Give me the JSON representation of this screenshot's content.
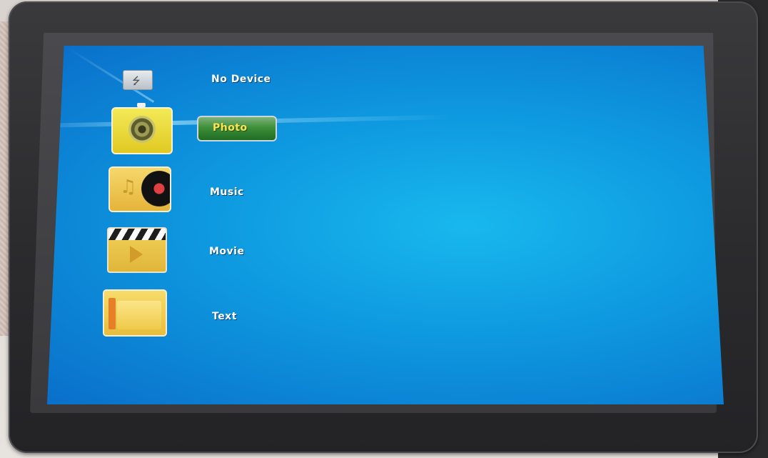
{
  "menu": {
    "device_status": "No Device",
    "items": [
      {
        "label": "Photo",
        "selected": true
      },
      {
        "label": "Music",
        "selected": false
      },
      {
        "label": "Movie",
        "selected": false
      },
      {
        "label": "Text",
        "selected": false
      }
    ]
  },
  "colors": {
    "screen_blue": "#0e98df",
    "selection_green": "#3f8f3a",
    "selected_text": "#ffe34c",
    "text": "#ffffff"
  },
  "icons": [
    "usb-drive-icon",
    "camera-icon",
    "music-icon",
    "movie-icon",
    "folder-icon"
  ]
}
